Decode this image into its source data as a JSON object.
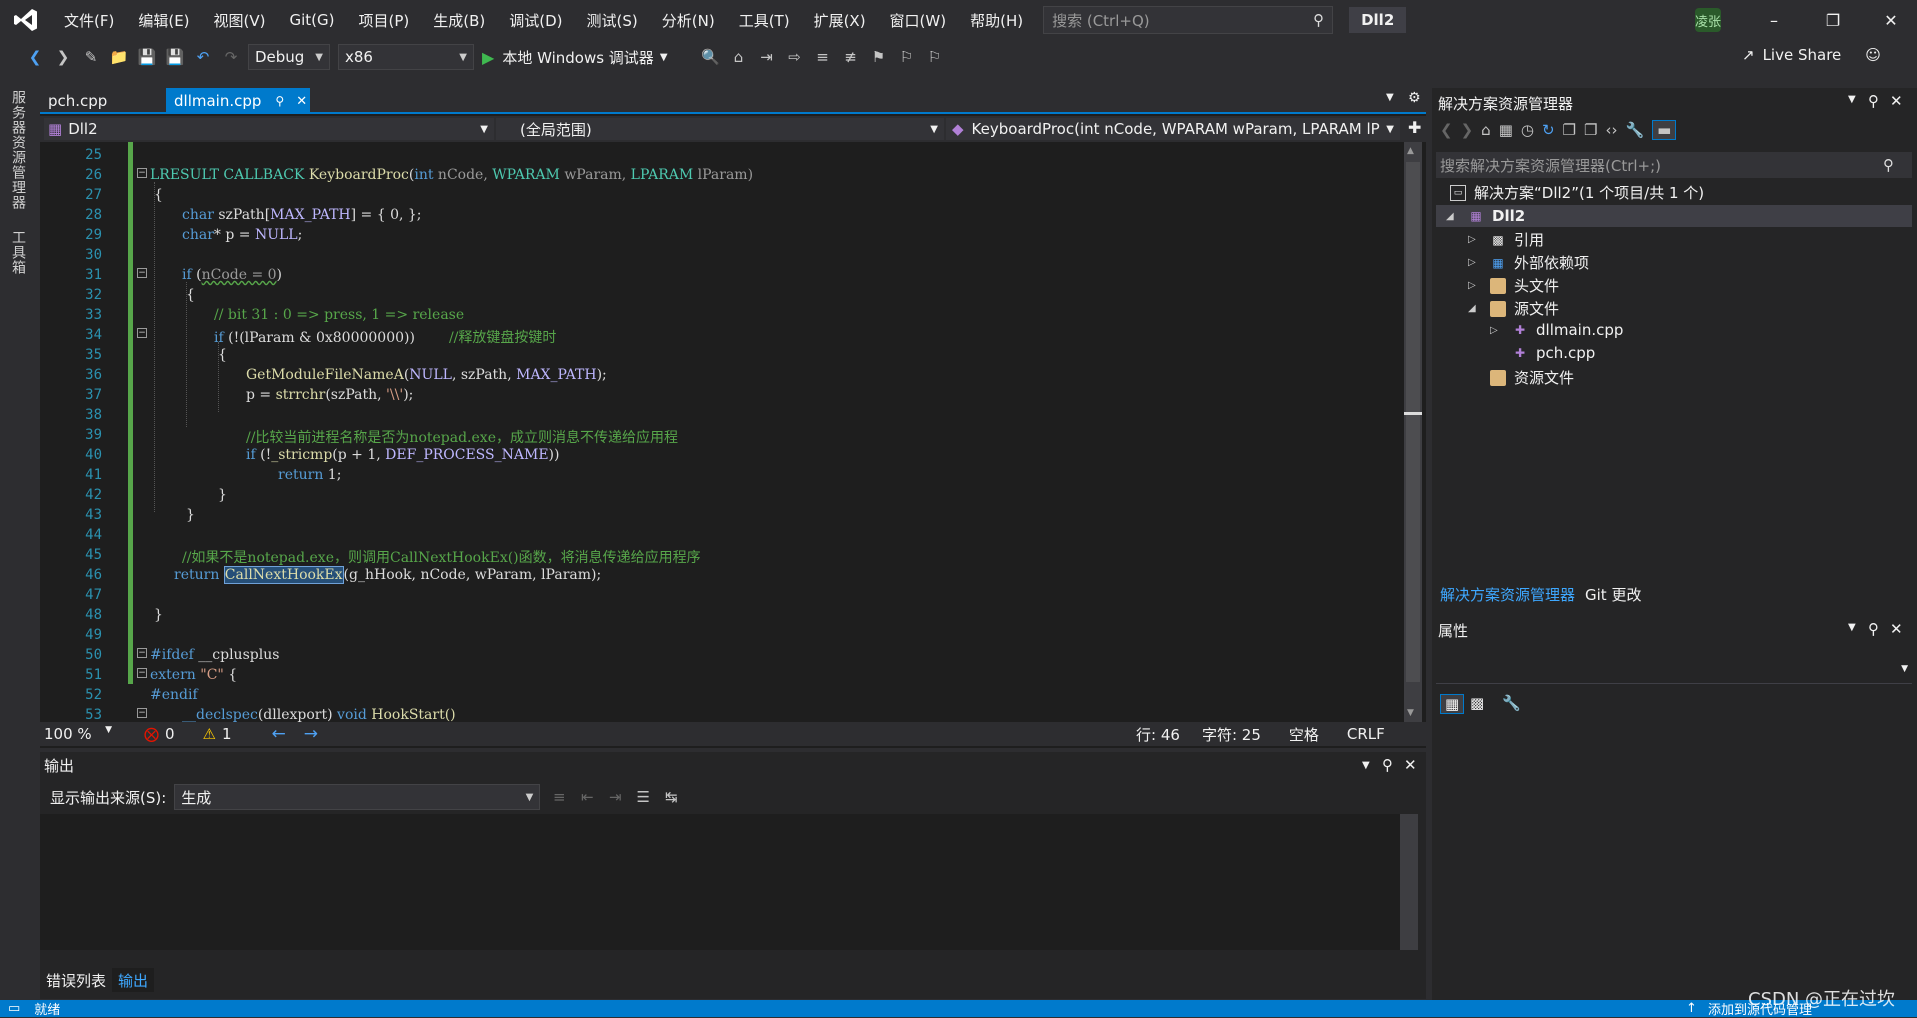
{
  "menu": [
    "文件(F)",
    "编辑(E)",
    "视图(V)",
    "Git(G)",
    "项目(P)",
    "生成(B)",
    "调试(D)",
    "测试(S)",
    "分析(N)",
    "工具(T)",
    "扩展(X)",
    "窗口(W)",
    "帮助(H)"
  ],
  "search": {
    "placeholder": "搜索 (Ctrl+Q)"
  },
  "solution_name": "Dll2",
  "user_initials": "凌张",
  "toolbar": {
    "config": "Debug",
    "platform": "x86",
    "run_label": "本地 Windows 调试器",
    "live_share": "Live Share"
  },
  "left_tabs": [
    "服务器资源管理器",
    "工具箱"
  ],
  "doc_tabs": [
    "pch.cpp",
    "dllmain.cpp"
  ],
  "nav": {
    "project": "Dll2",
    "scope": "(全局范围)",
    "member": "KeyboardProc(int nCode, WPARAM wParam, LPARAM lP"
  },
  "line_numbers": [
    "25",
    "26",
    "27",
    "28",
    "29",
    "30",
    "31",
    "32",
    "33",
    "34",
    "35",
    "36",
    "37",
    "38",
    "39",
    "40",
    "41",
    "42",
    "43",
    "44",
    "45",
    "46",
    "47",
    "48",
    "49",
    "50",
    "51",
    "52",
    "53"
  ],
  "code": {
    "l26a": "LRESULT CALLBACK ",
    "l26b": "KeyboardProc",
    "l26c": "(",
    "l26d": "int",
    "l26e": " nCode, ",
    "l26f": "WPARAM",
    "l26g": " wParam, ",
    "l26h": "LPARAM",
    "l26i": " lParam)",
    "l27": "{",
    "l28a": "char",
    "l28b": " szPath[",
    "l28c": "MAX_PATH",
    "l28d": "] = { 0, };",
    "l29a": "char",
    "l29b": "* p = ",
    "l29c": "NULL",
    "l29d": ";",
    "l31a": "if",
    "l31b": " (",
    "l31c": "nCode = 0",
    "l31d": ")",
    "l32": "{",
    "l33": "// bit 31 : 0 => press, 1 => release",
    "l34a": "if",
    "l34b": " (!(lParam & 0x80000000))",
    "l34c": "//释放键盘按键时",
    "l35": "{",
    "l36a": "GetModuleFileNameA",
    "l36b": "(",
    "l36c": "NULL",
    "l36d": ", szPath, ",
    "l36e": "MAX_PATH",
    "l36f": ");",
    "l37a": "p = ",
    "l37b": "strrchr",
    "l37c": "(szPath, ",
    "l37d": "'\\\\'",
    "l37e": ");",
    "l39": "//比较当前进程名称是否为notepad.exe，成立则消息不传递给应用程",
    "l40a": "if",
    "l40b": " (!",
    "l40c": "_stricmp",
    "l40d": "(p + 1, ",
    "l40e": "DEF_PROCESS_NAME",
    "l40f": "))",
    "l41a": "return",
    "l41b": " 1;",
    "l42": "}",
    "l43": "}",
    "l45": "//如果不是notepad.exe，则调用CallNextHookEx()函数，将消息传递给应用程序",
    "l46a": "return",
    "l46b": " ",
    "l46c": "CallNextHookEx",
    "l46d": "(g_hHook, nCode, wParam, lParam);",
    "l48": "}",
    "l50a": "#ifdef",
    "l50b": " __cplusplus",
    "l51a": "extern",
    "l51b": " \"C\"",
    "l51c": " {",
    "l52": "#endif",
    "l53a": "__declspec",
    "l53b": "(dllexport) ",
    "l53c": "void",
    "l53d": " HookStart()"
  },
  "status_row": {
    "zoom": "100 %",
    "errors": "0",
    "warnings": "1",
    "line": "行: 46",
    "char": "字符: 25",
    "space": "空格",
    "eol": "CRLF"
  },
  "output": {
    "title": "输出",
    "source_label": "显示输出来源(S):",
    "source_value": "生成"
  },
  "bottom_tabs": [
    "错误列表",
    "输出"
  ],
  "solution_explorer": {
    "title": "解决方案资源管理器",
    "search_placeholder": "搜索解决方案资源管理器(Ctrl+;)",
    "solution_label": "解决方案“Dll2”(1 个项目/共 1 个)",
    "project": "Dll2",
    "items": [
      "引用",
      "外部依赖项",
      "头文件",
      "源文件",
      "dllmain.cpp",
      "pch.cpp",
      "资源文件"
    ],
    "tabs": [
      "解决方案资源管理器",
      "Git 更改"
    ]
  },
  "properties": {
    "title": "属性"
  },
  "statusbar": {
    "ready": "就绪",
    "source_control": "添加到源代码管理"
  },
  "watermark": "CSDN @正在过坎",
  "colors": {
    "accent": "#007acc",
    "keyword": "#569cd6",
    "comment": "#57a64a",
    "type": "#4ec9b0"
  }
}
